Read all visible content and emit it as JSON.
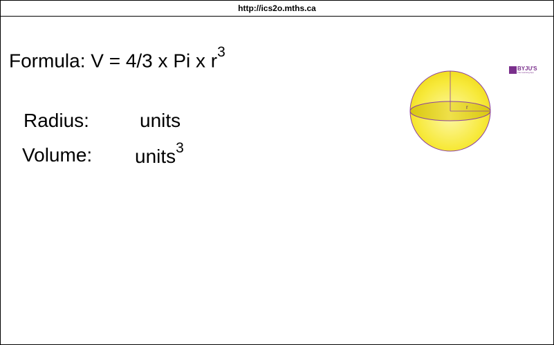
{
  "window": {
    "url": "http://ics2o.mths.ca"
  },
  "formula": {
    "text": "Formula: V = 4/3 x Pi x r",
    "exponent": "3"
  },
  "radius": {
    "label": "Radius:",
    "units": "units"
  },
  "volume": {
    "label": "Volume:",
    "units": "units",
    "units_exponent": "3"
  },
  "figure": {
    "radius_label": "r",
    "fill_color": "#f7e93a",
    "outline_color": "#8a3fa0"
  },
  "logo": {
    "text": "BYJU'S",
    "subtext": "The Learning App"
  }
}
